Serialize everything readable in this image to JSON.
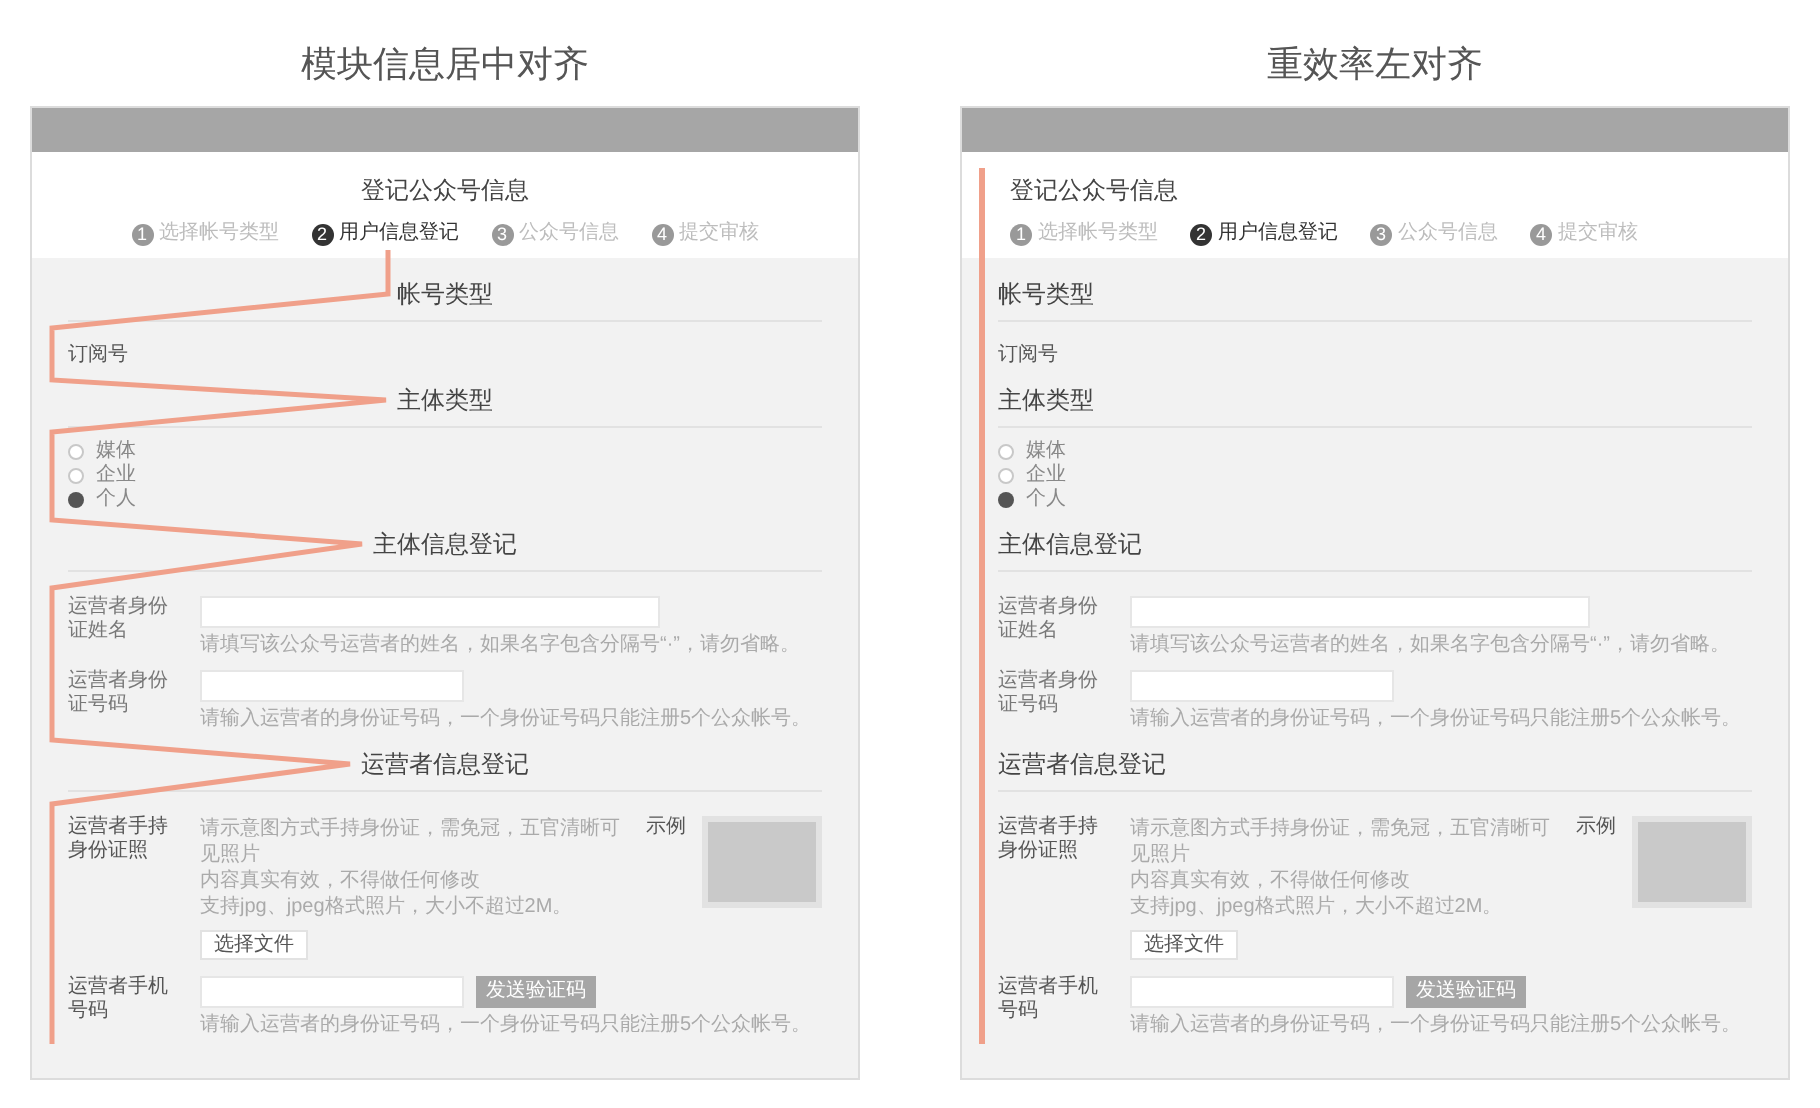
{
  "comparisons": [
    {
      "caption": "模块信息居中对齐",
      "kind": "centered",
      "form": {
        "title": "登记公众号信息",
        "steps": [
          {
            "number": "1",
            "label": "选择帐号类型",
            "selected": false
          },
          {
            "number": "2",
            "label": "用户信息登记",
            "selected": true
          },
          {
            "number": "3",
            "label": "公众号信息",
            "selected": false
          },
          {
            "number": "4",
            "label": "提交审核",
            "selected": false
          }
        ],
        "sections": [
          {
            "heading": "帐号类型",
            "items": [
              {
                "kind": "text",
                "text": "订阅号"
              }
            ]
          },
          {
            "heading": "主体类型",
            "items": [
              {
                "kind": "radio",
                "label": "媒体",
                "selected": false
              },
              {
                "kind": "radio",
                "label": "企业",
                "selected": false
              },
              {
                "kind": "radio",
                "label": "个人",
                "selected": true
              }
            ]
          },
          {
            "heading": "主体信息登记",
            "items": [
              {
                "kind": "name",
                "label": "运营者身份证姓名",
                "hint": "请填写该公众号运营者的姓名，如果名字包含分隔号“·”，请勿省略。"
              },
              {
                "kind": "idnumber",
                "label": "运营者身份证号码",
                "hint": "请输入运营者的身份证号码，一个身份证号码只能注册5个公众帐号。"
              }
            ]
          },
          {
            "heading": "运营者信息登记",
            "items": [
              {
                "kind": "upload",
                "label": "运营者手持身份证照",
                "hints": [
                  "请示意图方式手持身份证，需免冠，五官清晰可见照片",
                  "内容真实有效，不得做任何修改",
                  "支持jpg、jpeg格式照片，大小不超过2M。"
                ],
                "button": "选择文件",
                "example": "示例"
              },
              {
                "kind": "phone",
                "label": "运营者手机号码",
                "button": "发送验证码",
                "hint": "请输入运营者的身份证号码，一个身份证号码只能注册5个公众帐号。"
              }
            ]
          }
        ]
      }
    },
    {
      "caption": "重效率左对齐",
      "kind": "leftaligned",
      "form": {
        "title": "登记公众号信息",
        "steps": [
          {
            "number": "1",
            "label": "选择帐号类型",
            "selected": false
          },
          {
            "number": "2",
            "label": "用户信息登记",
            "selected": true
          },
          {
            "number": "3",
            "label": "公众号信息",
            "selected": false
          },
          {
            "number": "4",
            "label": "提交审核",
            "selected": false
          }
        ],
        "sections": [
          {
            "heading": "帐号类型",
            "items": [
              {
                "kind": "text",
                "text": "订阅号"
              }
            ]
          },
          {
            "heading": "主体类型",
            "items": [
              {
                "kind": "radio",
                "label": "媒体",
                "selected": false
              },
              {
                "kind": "radio",
                "label": "企业",
                "selected": false
              },
              {
                "kind": "radio",
                "label": "个人",
                "selected": true
              }
            ]
          },
          {
            "heading": "主体信息登记",
            "items": [
              {
                "kind": "name",
                "label": "运营者身份证姓名",
                "hint": "请填写该公众号运营者的姓名，如果名字包含分隔号“·”，请勿省略。"
              },
              {
                "kind": "idnumber",
                "label": "运营者身份证号码",
                "hint": "请输入运营者的身份证号码，一个身份证号码只能注册5个公众帐号。"
              }
            ]
          },
          {
            "heading": "运营者信息登记",
            "items": [
              {
                "kind": "upload",
                "label": "运营者手持身份证照",
                "hints": [
                  "请示意图方式手持身份证，需免冠，五官清晰可见照片",
                  "内容真实有效，不得做任何修改",
                  "支持jpg、jpeg格式照片，大小不超过2M。"
                ],
                "button": "选择文件",
                "example": "示例"
              },
              {
                "kind": "phone",
                "label": "运营者手机号码",
                "button": "发送验证码",
                "hint": "请输入运营者的身份证号码，一个身份证号码只能注册5个公众帐号。"
              }
            ]
          }
        ]
      }
    }
  ]
}
